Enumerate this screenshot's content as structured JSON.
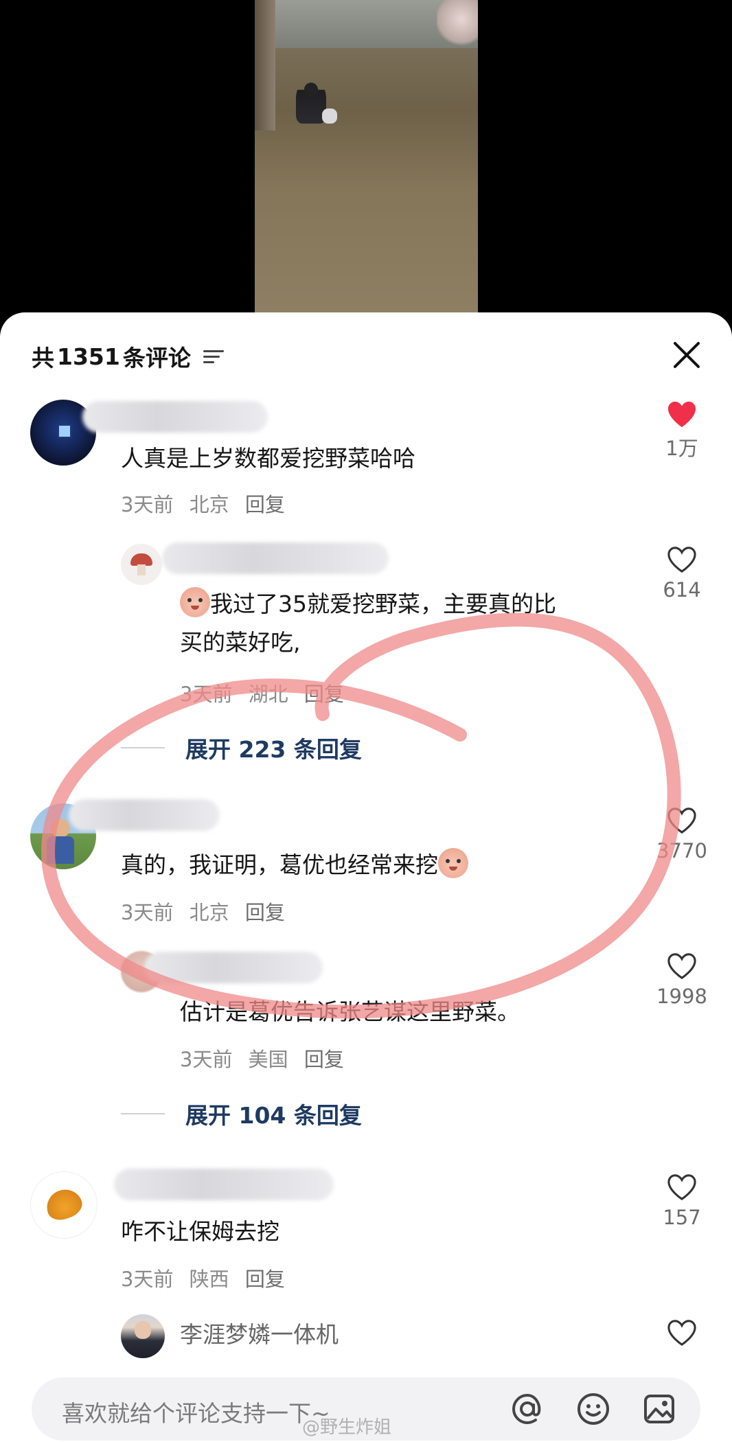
{
  "header": {
    "title_prefix": "共",
    "count": "1351",
    "title_suffix": "条评论"
  },
  "comments": [
    {
      "text": "人真是上岁数都爱挖野菜哈哈",
      "time": "3天前",
      "location": "北京",
      "reply_label": "回复",
      "likes": "1万",
      "liked": true,
      "replies": [
        {
          "text_line1": "我过了35就爱挖野菜，主要真的比",
          "text_line2": "买的菜好吃,",
          "time": "3天前",
          "location": "湖北",
          "reply_label": "回复",
          "likes": "614"
        }
      ],
      "expand_label": "展开 223 条回复"
    },
    {
      "text": "真的，我证明，葛优也经常来挖",
      "time": "3天前",
      "location": "北京",
      "reply_label": "回复",
      "likes": "3770",
      "liked": false,
      "replies": [
        {
          "text_line1": "估计是葛优告诉张艺谋这里野菜。",
          "time": "3天前",
          "location": "美国",
          "reply_label": "回复",
          "likes": "1998"
        }
      ],
      "expand_label": "展开 104 条回复"
    },
    {
      "text": "咋不让保姆去挖",
      "time": "3天前",
      "location": "陕西",
      "reply_label": "回复",
      "likes": "157",
      "liked": false
    },
    {
      "username": "李涯梦嫾一体机"
    }
  ],
  "input": {
    "placeholder": "喜欢就给个评论支持一下~"
  },
  "watermark": "@野生炸姐",
  "colors": {
    "liked_heart": "#f0304a",
    "annotation_circle": "#ef8a8a",
    "expand_text": "#1f3a62"
  },
  "icons": [
    "filter-icon",
    "close-icon",
    "heart-icon",
    "at-icon",
    "emoji-icon",
    "image-icon"
  ]
}
